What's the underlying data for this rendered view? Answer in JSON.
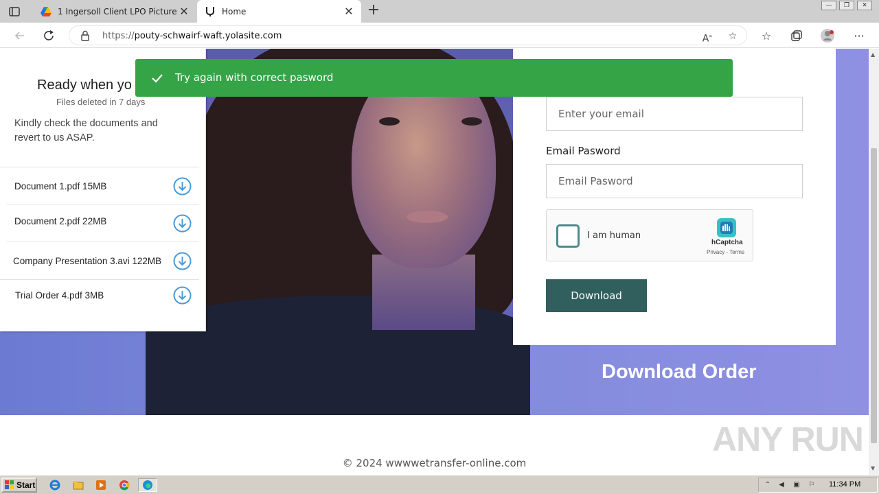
{
  "browser": {
    "tabs": [
      {
        "title": "1 Ingersoll Client LPO Pictures &",
        "icon": "google-drive-icon",
        "active": false
      },
      {
        "title": "Home",
        "icon": "yola-icon",
        "active": true
      }
    ],
    "url_prefix": "https://",
    "url_host": "pouty-schwairf-waft.yolasite.com"
  },
  "toast": {
    "message": "Try again with correct pasword",
    "color": "#35a447"
  },
  "left_card": {
    "title": "Ready when yo",
    "subtitle": "Files deleted in 7 days",
    "message": "Kindly check the documents and revert to us ASAP.",
    "documents": [
      {
        "name": "Document 1.pdf 15MB"
      },
      {
        "name": "Document 2.pdf 22MB"
      },
      {
        "name": "Company Presentation 3.avi 122MB"
      },
      {
        "name": "Trial Order 4.pdf 3MB"
      }
    ]
  },
  "form": {
    "email_placeholder": "Enter your email",
    "password_label": "Email Pasword",
    "password_placeholder": "Email Pasword",
    "captcha_label": "I am human",
    "captcha_brand": "hCaptcha",
    "captcha_links": "Privacy - Terms",
    "download_label": "Download",
    "button_color": "#315f5d"
  },
  "hero": {
    "title": "Download Order"
  },
  "footer": {
    "copyright": "© 2024 wwwwetransfer-online.com"
  },
  "watermark": "ANY RUN",
  "taskbar": {
    "start_label": "Start",
    "clock": "11:34 PM"
  }
}
